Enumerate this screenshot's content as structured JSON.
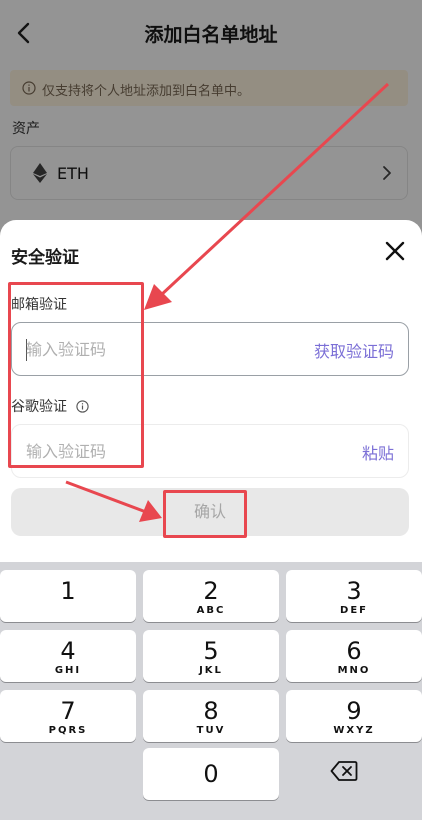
{
  "page": {
    "title": "添加白名单地址",
    "notice": "仅支持将个人地址添加到白名单中。",
    "asset_label": "资产",
    "asset_value": "ETH"
  },
  "sheet": {
    "title": "安全验证",
    "email_label": "邮箱验证",
    "email_placeholder": "输入验证码",
    "get_code_label": "获取验证码",
    "google_label": "谷歌验证",
    "google_placeholder": "输入验证码",
    "paste_label": "粘贴",
    "confirm_label": "确认"
  },
  "keypad": {
    "keys": [
      {
        "num": "1",
        "letters": ""
      },
      {
        "num": "2",
        "letters": "ABC"
      },
      {
        "num": "3",
        "letters": "DEF"
      },
      {
        "num": "4",
        "letters": "GHI"
      },
      {
        "num": "5",
        "letters": "JKL"
      },
      {
        "num": "6",
        "letters": "MNO"
      },
      {
        "num": "7",
        "letters": "PQRS"
      },
      {
        "num": "8",
        "letters": "TUV"
      },
      {
        "num": "9",
        "letters": "WXYZ"
      },
      {
        "num": "0",
        "letters": ""
      }
    ]
  },
  "icons": {
    "back": "chevron-left-icon",
    "notice": "info-circle-icon",
    "asset": "eth-icon",
    "asset_chevron": "chevron-right-icon",
    "close": "close-icon",
    "google_info": "info-circle-icon",
    "backspace": "backspace-icon"
  },
  "colors": {
    "accent": "#7b6fd6",
    "annotation": "#e8474f",
    "notice_bg": "#fff4e0",
    "confirm_disabled_bg": "#e8e8e8"
  }
}
